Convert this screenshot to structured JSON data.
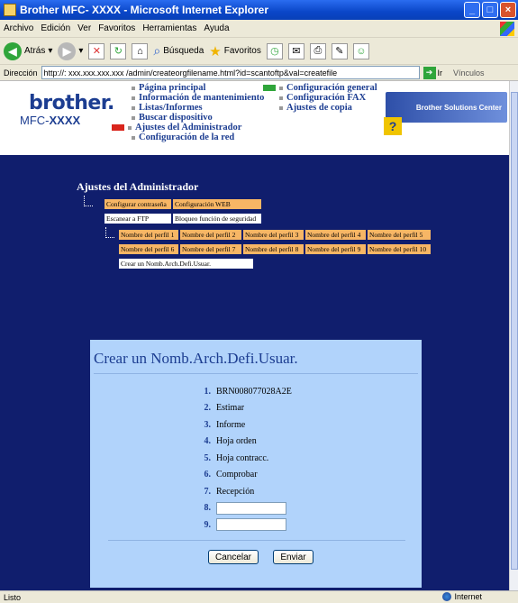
{
  "window": {
    "title": "Brother MFC- XXXX  - Microsoft Internet Explorer"
  },
  "menu": [
    "Archivo",
    "Edición",
    "Ver",
    "Favoritos",
    "Herramientas",
    "Ayuda"
  ],
  "toolbar": {
    "back": "Atrás",
    "search": "Búsqueda",
    "favorites": "Favoritos"
  },
  "address": {
    "label": "Dirección",
    "url": "http://: xxx.xxx.xxx.xxx  /admin/createorgfilename.html?id=scantoftp&val=createfile",
    "go": "Ir",
    "links": "Vínculos"
  },
  "header": {
    "logo": "brother.",
    "model_prefix": "MFC-",
    "model": "XXXX",
    "nav_left": [
      "Página principal",
      "Información de mantenimiento",
      "Listas/Informes",
      "Buscar dispositivo",
      "Ajustes del Administrador",
      "Configuración de la red"
    ],
    "nav_right": [
      "Configuración general",
      "Configuración FAX",
      "Ajustes de copia"
    ],
    "solutions": "Brother Solutions Center"
  },
  "admin": {
    "title": "Ajustes del Administrador",
    "row1": [
      "Configurar contraseña",
      "Configuración WEB"
    ],
    "row2": [
      "Escanear a FTP",
      "Bloqueo función de seguridad"
    ],
    "profiles1": [
      "Nombre del perfil 1",
      "Nombre del perfil 2",
      "Nombre del perfil 3",
      "Nombre del perfil 4",
      "Nombre del perfil 5"
    ],
    "profiles2": [
      "Nombre del perfil 6",
      "Nombre del perfil 7",
      "Nombre del perfil 8",
      "Nombre del perfil 9",
      "Nombre del perfil 10"
    ],
    "current": "Crear un Nomb.Arch.Defi.Usuar."
  },
  "form": {
    "title": "Crear un Nomb.Arch.Defi.Usuar.",
    "items": [
      {
        "num": "1.",
        "label": "BRN008077028A2E"
      },
      {
        "num": "2.",
        "label": "Estimar"
      },
      {
        "num": "3.",
        "label": "Informe"
      },
      {
        "num": "4.",
        "label": "Hoja orden"
      },
      {
        "num": "5.",
        "label": "Hoja contracc."
      },
      {
        "num": "6.",
        "label": "Comprobar"
      },
      {
        "num": "7.",
        "label": "Recepción"
      },
      {
        "num": "8.",
        "label": ""
      },
      {
        "num": "9.",
        "label": ""
      }
    ],
    "cancel": "Cancelar",
    "submit": "Enviar"
  },
  "status": {
    "text": "Listo",
    "zone": "Internet"
  }
}
